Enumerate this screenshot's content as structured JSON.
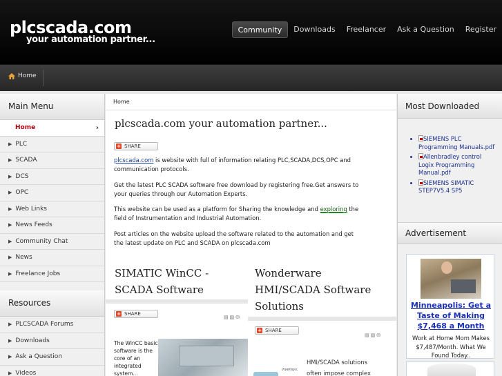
{
  "header": {
    "logo": "plcscada.com",
    "tagline": "your automation partner...",
    "nav": [
      "Community",
      "Downloads",
      "Freelancer",
      "Ask a Question",
      "Register"
    ],
    "active_nav": "Community"
  },
  "breadcrumb_bar": {
    "home": "Home"
  },
  "left_sidebar": {
    "main_menu_title": "Main Menu",
    "main_menu": [
      "Home",
      "PLC",
      "SCADA",
      "DCS",
      "OPC",
      "Web Links",
      "News Feeds",
      "Community Chat",
      "News",
      "Freelance Jobs"
    ],
    "resources_title": "Resources",
    "resources": [
      "PLCSCADA Forums",
      "Downloads",
      "Ask a Question",
      "Videos"
    ]
  },
  "main": {
    "breadcrumb": "Home",
    "title": "plcscada.com your automation partner...",
    "share_label": "SHARE",
    "p1_link": "plcscada.com",
    "p1_rest": " is website with full of information relating PLC,SCADA,DCS,OPC and communication protocols.",
    "p2": "Get the latest PLC SCADA software free download by registering free.Get answers to your queries through our Automation Experts.",
    "p3_a": "This website can be used as a platform for Sharing the knowledge and ",
    "p3_link": "exploring",
    "p3_b": " the field of Instrumentation and Industrial Automation.",
    "p4": "Post articles on the website upload the software related to the automation and get the latest update on PLC and SCADA on plcscada.com",
    "col1_title_1": "SIMATIC WinCC -",
    "col1_title_2": "SCADA Software",
    "col1_text": "The WinCC basic software is the core of an integrated system...",
    "col2_title_1": "Wonderware",
    "col2_title_2": "HMI/SCADA Software",
    "col2_title_3": "Solutions",
    "col2_text": "HMI/SCADA solutions often impose complex",
    "col2_logo_text": "invensys."
  },
  "right_sidebar": {
    "downloads_title": "Most Downloaded",
    "downloads": [
      "SIEMENS PLC Programming Manuals.pdf",
      "Allenbradley control Logix Programming Manual.pdf",
      "SIEMENS SIMATIC STEP7V5.4 SP5"
    ],
    "ad_title": "Advertisement",
    "ad_headline": "Minneapolis: Get a Taste of Making $7,468 a Month",
    "ad_text": "Work at Home Mom Makes $7,487/Month. What We Found Today.."
  }
}
